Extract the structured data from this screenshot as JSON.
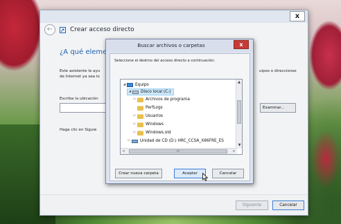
{
  "wizard": {
    "close_glyph": "x",
    "back_glyph": "←",
    "title": "Crear acceso directo",
    "heading": "¿A qué elemen",
    "assist_line1": "Este asistente le ayu",
    "assist_line2": "de Internet ya sea lo",
    "assist_tail": "uipos o direcciones",
    "location_label": "Escriba la ubicación",
    "location_value": "",
    "browse_button": "Examinar...",
    "click_text": "Haga clic en Siguie",
    "next_button": "Siguiente",
    "cancel_button": "Cancelar"
  },
  "browse_dialog": {
    "title": "Buscar archivos o carpetas",
    "close_glyph": "x",
    "description": "Seleccione el destino del acceso directo a continuación:",
    "tree": [
      {
        "label": "Equipo",
        "icon": "computer-icon",
        "expander": "◢"
      },
      {
        "label": "Disco local (C:)",
        "icon": "drive-icon",
        "expander": "◢",
        "selected": true
      },
      {
        "label": "Archivos de programa",
        "icon": "folder-icon",
        "expander": "▷"
      },
      {
        "label": "PerfLogs",
        "icon": "folder-icon",
        "expander": ""
      },
      {
        "label": "Usuarios",
        "icon": "folder-icon",
        "expander": "▷"
      },
      {
        "label": "Windows",
        "icon": "folder-icon",
        "expander": "▷"
      },
      {
        "label": "Windows.old",
        "icon": "folder-icon",
        "expander": "▷"
      },
      {
        "label": "Unidad de CD (D:) HRC_CCSA_X86FRE_ES",
        "icon": "cd-icon",
        "expander": "▷"
      }
    ],
    "scroll_up": "▲",
    "scroll_down": "▼",
    "scroll_left": "<",
    "scroll_right": ">",
    "scroll_grip": "III",
    "new_folder_button": "Crear nueva carpeta",
    "accept_button": "Aceptar",
    "cancel_button": "Cancelar"
  }
}
